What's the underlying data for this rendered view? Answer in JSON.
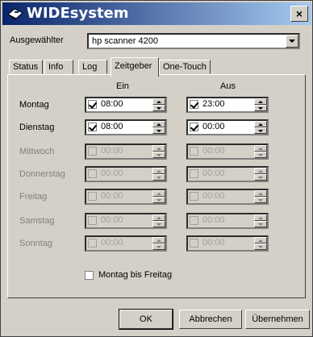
{
  "window": {
    "title": "WIDEsystem",
    "close_label": "×"
  },
  "selector": {
    "label": "Ausgewählter",
    "value": "hp scanner 4200"
  },
  "tabs": [
    {
      "label": "Status"
    },
    {
      "label": "Info"
    },
    {
      "label": "Log"
    },
    {
      "label": "Zeitgeber",
      "active": true
    },
    {
      "label": "One-Touch"
    }
  ],
  "columns": {
    "on": "Ein",
    "off": "Aus"
  },
  "days": [
    {
      "name": "Montag",
      "on_checked": true,
      "on_time": "08:00",
      "off_checked": true,
      "off_time": "23:00",
      "enabled": true
    },
    {
      "name": "Dienstag",
      "on_checked": true,
      "on_time": "08:00",
      "off_checked": true,
      "off_time": "00:00",
      "enabled": true
    },
    {
      "name": "Mittwoch",
      "on_checked": false,
      "on_time": "00:00",
      "off_checked": false,
      "off_time": "00:00",
      "enabled": false
    },
    {
      "name": "Donnerstag",
      "on_checked": false,
      "on_time": "00:00",
      "off_checked": false,
      "off_time": "00:00",
      "enabled": false
    },
    {
      "name": "Freitag",
      "on_checked": false,
      "on_time": "00:00",
      "off_checked": false,
      "off_time": "00:00",
      "enabled": false
    },
    {
      "name": "Samstag",
      "on_checked": false,
      "on_time": "00:00",
      "off_checked": false,
      "off_time": "00:00",
      "enabled": false
    },
    {
      "name": "Sonntag",
      "on_checked": false,
      "on_time": "00:00",
      "off_checked": false,
      "off_time": "00:00",
      "enabled": false
    }
  ],
  "weekdays_checkbox": {
    "label": "Montag bis Freitag",
    "checked": false
  },
  "buttons": {
    "ok": "OK",
    "cancel": "Abbrechen",
    "apply": "Übernehmen"
  }
}
